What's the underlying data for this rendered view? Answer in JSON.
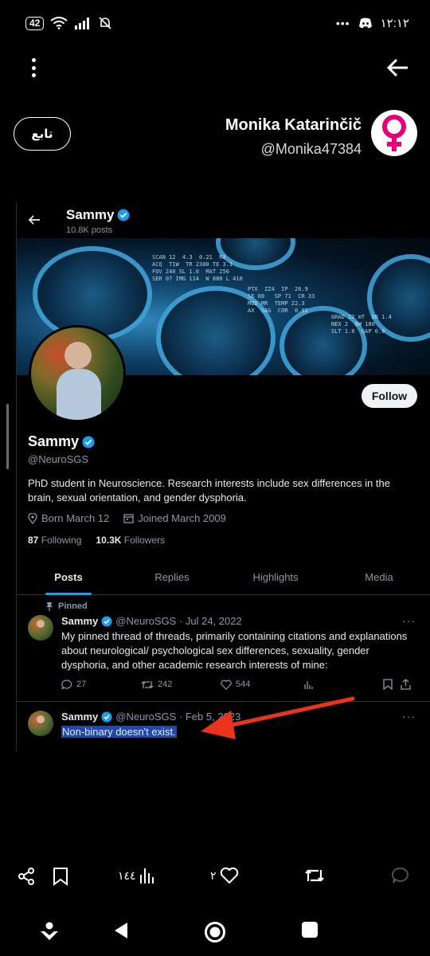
{
  "status_bar": {
    "battery": "42",
    "time": "١٢:١٢",
    "icons": [
      "wifi-icon",
      "signal-icon",
      "mute-bell-icon",
      "dots-icon",
      "discord-icon"
    ]
  },
  "profile": {
    "follow_label": "تابع",
    "name": "Monika Katarinčič",
    "handle": "@Monika47384",
    "avatar_icon": "female-symbol-icon",
    "avatar_color": "#e4007c"
  },
  "embedded": {
    "header_name": "Sammy",
    "posts_count": "10.8K posts",
    "follow_button": "Follow",
    "name": "Sammy",
    "handle": "@NeuroSGS",
    "bio": "PhD student in Neuroscience. Research interests include sex differences in the brain, sexual orientation, and gender dysphoria.",
    "born": "Born March 12",
    "joined": "Joined March 2009",
    "following_count": "87",
    "following_label": "Following",
    "followers_count": "10.3K",
    "followers_label": "Followers",
    "tabs": [
      "Posts",
      "Replies",
      "Highlights",
      "Media"
    ],
    "pinned_label": "Pinned",
    "tweet1": {
      "name": "Sammy",
      "meta": "@NeuroSGS · Jul 24, 2022",
      "text": "My pinned thread of threads, primarily containing citations and explanations about neurological/ psychological sex differences, sexuality, gender dysphoria, and other academic research interests of mine:",
      "replies": "27",
      "retweets": "242",
      "likes": "544"
    },
    "tweet2": {
      "name": "Sammy",
      "meta": "@NeuroSGS · Feb 5, 2023",
      "text": "Non-binary doesn't exist."
    },
    "accent": "#1d9bf0",
    "highlight_color": "#1f4aa8"
  },
  "annotation_arrow_color": "#e8341c",
  "bottom_bar": {
    "views": "١٤٤",
    "likes": "٢"
  }
}
